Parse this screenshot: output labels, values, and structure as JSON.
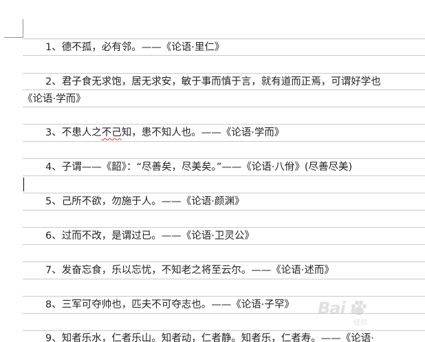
{
  "document": {
    "lines": [
      {
        "text": "1、德不孤，必有邻。——《论语·里仁》"
      },
      {
        "text": "2、君子食无求饱，居无求安，敏于事而慎于言，就有道而正焉，可谓好学也"
      },
      {
        "text": "《论语·学而》"
      },
      {
        "pre": "3、不患人之",
        "mark": "不己",
        "post": "知，患不知人也。——《论语·学而》"
      },
      {
        "text": "4、子谓——《韶》：“尽善矣，尽美矣。”——《论语·八佾》(尽善尽美)"
      },
      {
        "text": "5、己所不欲，勿施于人。——《论语·颜渊》"
      },
      {
        "text": "6、过而不改，是谓过已。——《论语·卫灵公》"
      },
      {
        "text": "7、发奋忘食，乐以忘忧，不知老之将至云尔。——《论语·述而》"
      },
      {
        "text": "8、三军可夺帅也，匹夫不可夺志也。——《论语·子罕》"
      },
      {
        "text": "9、知者乐水，仁者乐山。知者动，仁者静。知者乐，仁者寿。——《论语·"
      }
    ]
  },
  "watermark": {
    "brand": "Bai  u",
    "sub": "经验"
  },
  "colors": {
    "text": "#222222",
    "rule": "#c9c9c9",
    "spellcheck": "#e0271f",
    "watermark": "#c8c8c8"
  }
}
